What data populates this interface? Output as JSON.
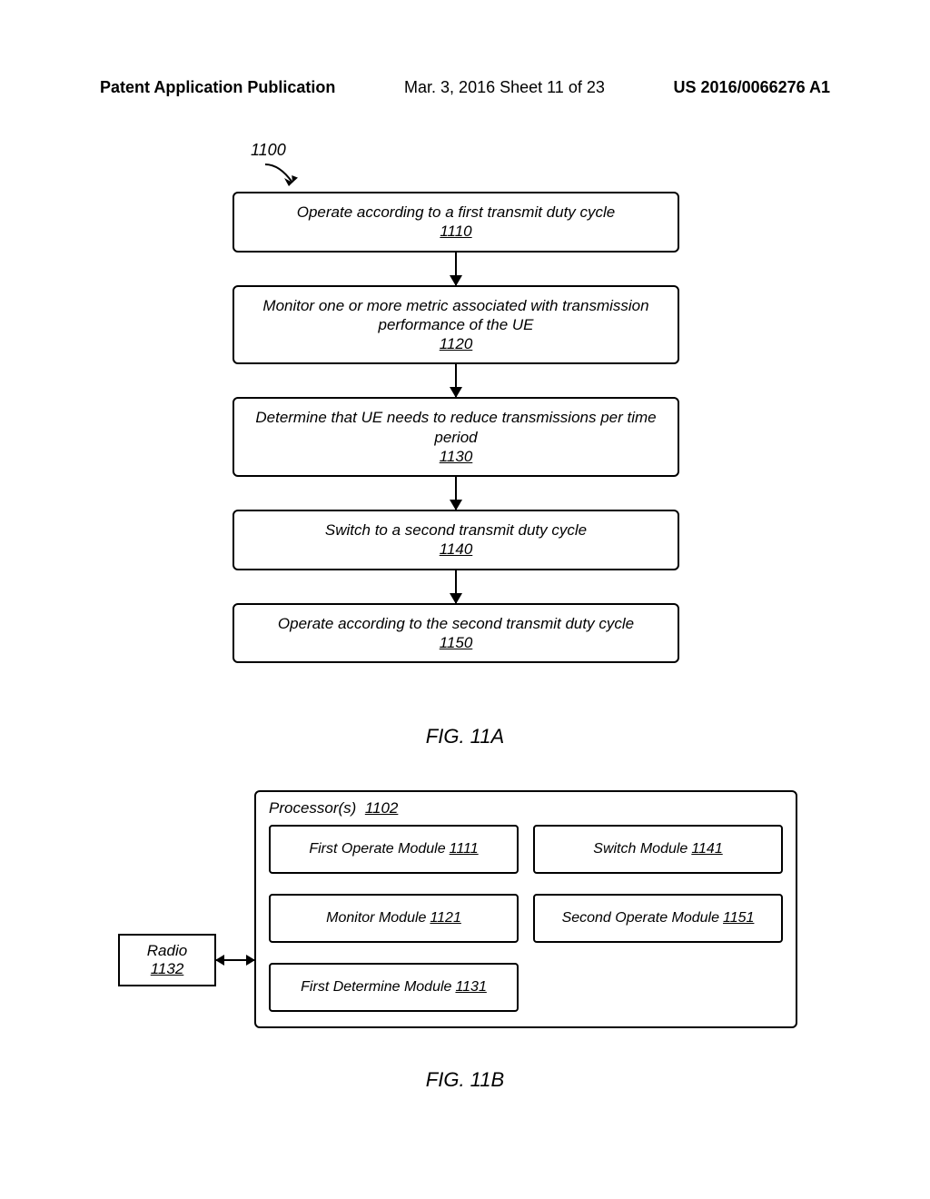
{
  "header": {
    "left": "Patent Application Publication",
    "mid": "Mar. 3, 2016  Sheet 11 of 23",
    "right": "US 2016/0066276 A1"
  },
  "flow": {
    "ref": "1100",
    "steps": [
      {
        "text": "Operate according to a first transmit duty cycle",
        "num": "1110"
      },
      {
        "text": "Monitor one or more metric associated with transmission performance of the UE",
        "num": "1120"
      },
      {
        "text": "Determine that UE needs to reduce transmissions per time period",
        "num": "1130"
      },
      {
        "text": "Switch to a second transmit duty cycle",
        "num": "1140"
      },
      {
        "text": "Operate according to the second transmit duty cycle",
        "num": "1150"
      }
    ]
  },
  "fig_a": "FIG. 11A",
  "block": {
    "radio": {
      "label": "Radio",
      "num": "1132"
    },
    "proc": {
      "label": "Processor(s)",
      "num": "1102"
    },
    "modules": [
      {
        "label": "First Operate Module",
        "num": "1111"
      },
      {
        "label": "Switch Module",
        "num": "1141"
      },
      {
        "label": "Monitor Module",
        "num": "1121"
      },
      {
        "label": "Second Operate Module",
        "num": "1151"
      },
      {
        "label": "First Determine Module",
        "num": "1131"
      }
    ]
  },
  "fig_b": "FIG. 11B"
}
